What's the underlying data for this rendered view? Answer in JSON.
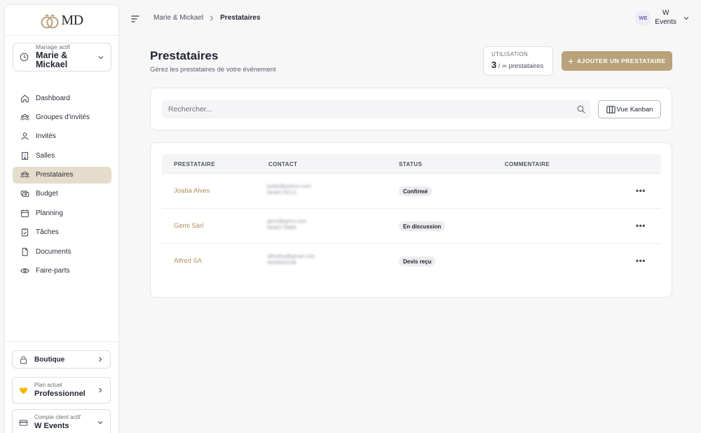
{
  "brand": {
    "logo_text": "MD"
  },
  "wedding_selector": {
    "label": "Mariage actif",
    "value": "Marie & Mickael"
  },
  "sidebar": {
    "items": [
      {
        "label": "Dashboard",
        "icon": "home-icon",
        "active": false
      },
      {
        "label": "Groupes d'invités",
        "icon": "groups-icon",
        "active": false
      },
      {
        "label": "Invités",
        "icon": "users-icon",
        "active": false
      },
      {
        "label": "Salles",
        "icon": "building-icon",
        "active": false
      },
      {
        "label": "Prestataires",
        "icon": "vendors-icon",
        "active": true
      },
      {
        "label": "Budget",
        "icon": "budget-icon",
        "active": false
      },
      {
        "label": "Planning",
        "icon": "calendar-icon",
        "active": false
      },
      {
        "label": "Tâches",
        "icon": "clipboard-check-icon",
        "active": false
      },
      {
        "label": "Documents",
        "icon": "file-icon",
        "active": false
      },
      {
        "label": "Faire-parts",
        "icon": "eye-icon",
        "active": false
      }
    ],
    "boutique_label": "Boutique",
    "plan": {
      "label": "Plan actuel",
      "value": "Professionnel"
    },
    "account": {
      "label": "Compte client actif",
      "value": "W Events"
    }
  },
  "breadcrumb": {
    "parent": "Marie & Mickael",
    "current": "Prestataires"
  },
  "user": {
    "initials": "WE",
    "name_line1": "W",
    "name_line2": "Events"
  },
  "page": {
    "title": "Prestataires",
    "subtitle": "Gérez les prestataires de votre événement",
    "usage_label": "UTILISATION",
    "usage_count": "3",
    "usage_rest": "/ ∞ prestataires",
    "add_button": "AJOUTER UN PRESTATAIRE",
    "search_placeholder": "Rechercher...",
    "kanban_button": "Vue Kanban"
  },
  "table": {
    "headers": {
      "name": "PRESTATAIRE",
      "contact": "CONTACT",
      "status": "STATUS",
      "comment": "COMMENTAIRE"
    },
    "rows": [
      {
        "name": "Joaba Alves",
        "email": "joaba@yahoo.com",
        "phone": "0648178213",
        "status": "Confirmé"
      },
      {
        "name": "Gemi Sàrl",
        "email": "gemi@gemi.com",
        "phone": "0648178865",
        "status": "En discussion"
      },
      {
        "name": "Alfred SA",
        "email": "alfredsa@gmail.com",
        "phone": "0645834158",
        "status": "Devis reçu"
      }
    ]
  },
  "colors": {
    "accent": "#b9a27a",
    "active_nav": "#e6dccb",
    "vendor_link": "#b08e5c",
    "plan_heart": "#f2b705"
  }
}
